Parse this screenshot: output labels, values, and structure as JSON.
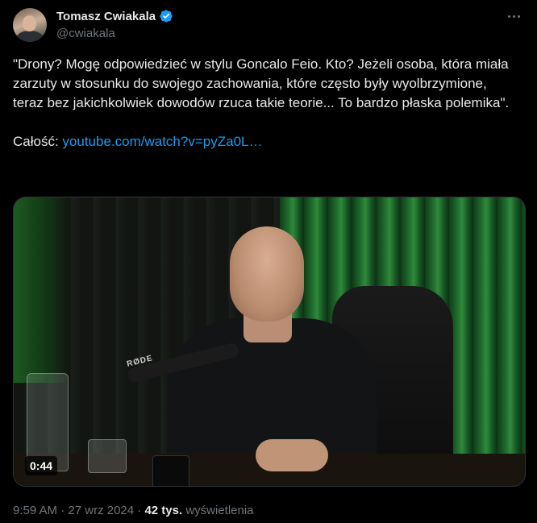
{
  "author": {
    "display_name": "Tomasz Cwiakala",
    "handle": "@cwiakala",
    "verified": true,
    "avatar_icon": "profile-photo"
  },
  "menu_icon": "more-dots-icon",
  "tweet": {
    "line1": "\"Drony? Mogę odpowiedzieć w stylu Goncalo Feio. Kto? Jeżeli osoba, która miała zarzuty w stosunku do swojego zachowania, które często były wyolbrzymione, teraz bez jakichkolwiek dowodów rzuca takie teorie... To bardzo płaska polemika\".",
    "link_prefix": "Całość: ",
    "link_text": "youtube.com/watch?v=pyZa0L…"
  },
  "media": {
    "duration": "0:44",
    "mic_brand": "RØDE"
  },
  "footer": {
    "time": "9:59 AM",
    "separator": "·",
    "date": "27 wrz 2024",
    "views_count": "42 tys.",
    "views_label": "wyświetlenia"
  },
  "colors": {
    "background": "#000000",
    "text": "#e7e9ea",
    "muted": "#71767b",
    "link": "#1d9bf0"
  }
}
